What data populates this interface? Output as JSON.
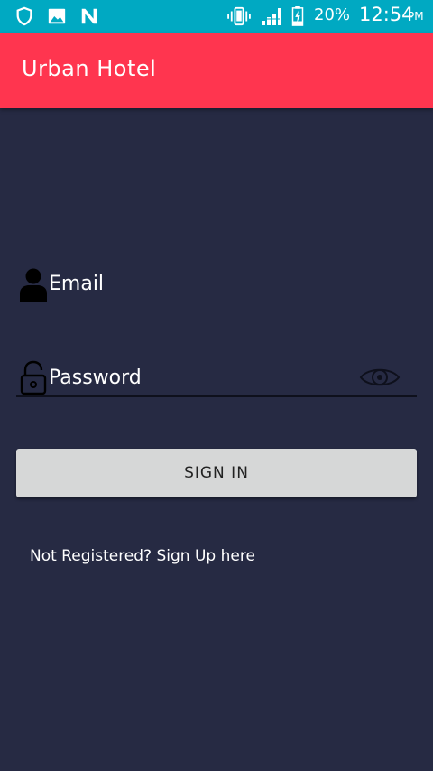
{
  "status_bar": {
    "battery_percent": "20%",
    "time": "12:54",
    "am_pm": "PM",
    "icons": [
      "shield-icon",
      "image-icon",
      "n-notification-icon",
      "vibrate-icon",
      "signal-icon",
      "battery-charging-icon"
    ]
  },
  "app_bar": {
    "title": "Urban Hotel",
    "color": "#ff354f"
  },
  "form": {
    "email_label": "Email",
    "password_label": "Password",
    "email_icon": "person-icon",
    "password_icon": "lock-icon",
    "visibility_icon": "eye-icon"
  },
  "signin_button": {
    "label": "SIGN IN"
  },
  "register_link": {
    "text": "Not Registered? Sign Up here"
  },
  "colors": {
    "background": "#262a43",
    "status_bar": "#00a9c2",
    "button": "#d6d7d7"
  }
}
